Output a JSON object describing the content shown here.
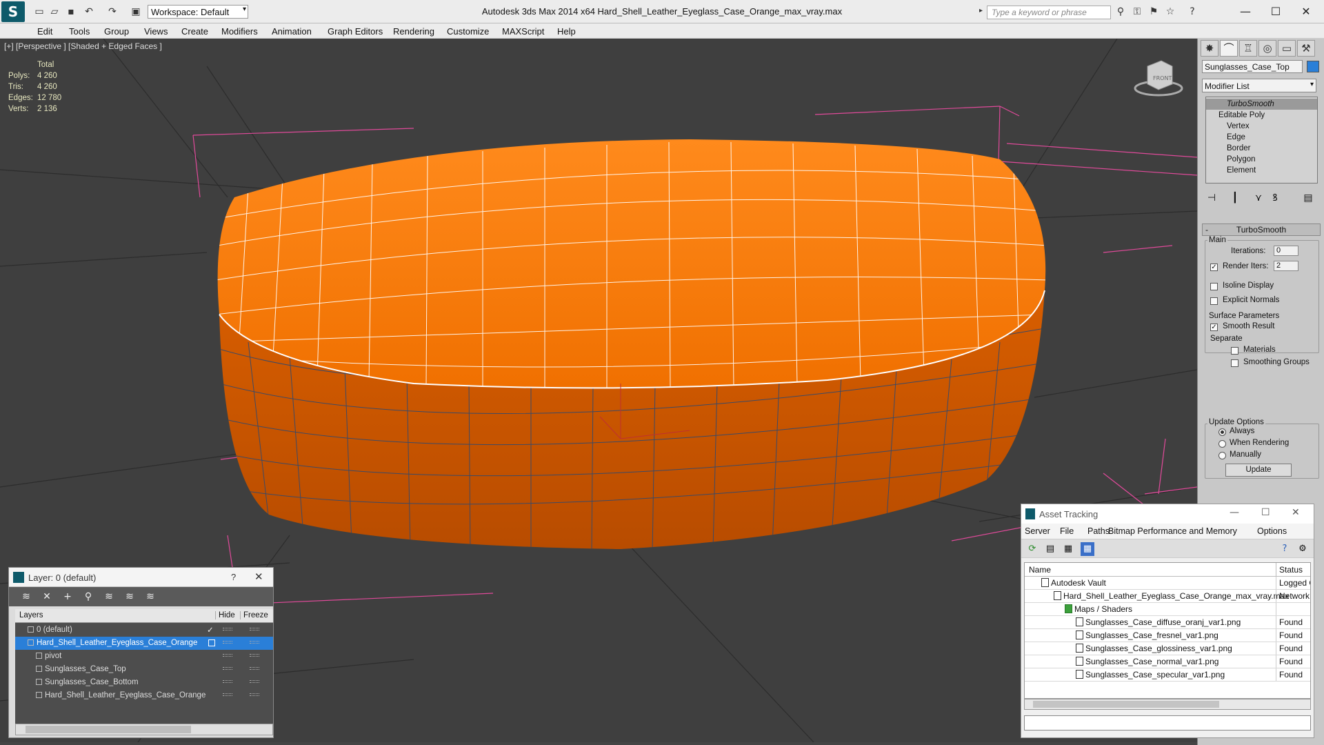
{
  "app": {
    "title": "Autodesk 3ds Max  2014 x64      Hard_Shell_Leather_Eyeglass_Case_Orange_max_vray.max",
    "workspace": "Workspace: Default",
    "search_placeholder": "Type a keyword or phrase",
    "app_letter": "S"
  },
  "menu": [
    "Edit",
    "Tools",
    "Group",
    "Views",
    "Create",
    "Modifiers",
    "Animation",
    "Graph Editors",
    "Rendering",
    "Customize",
    "MAXScript",
    "Help"
  ],
  "viewport": {
    "label": "[+] [Perspective ] [Shaded + Edged Faces ]",
    "stats_header": "Total",
    "stats": [
      {
        "label": "Polys:",
        "value": "4 260"
      },
      {
        "label": "Tris:",
        "value": "4 260"
      },
      {
        "label": "Edges:",
        "value": "12 780"
      },
      {
        "label": "Verts:",
        "value": "2 136"
      }
    ],
    "object_color": "#f06a00",
    "viewcube_label": "FRONT"
  },
  "command_panel": {
    "object_name": "Sunglasses_Case_Top",
    "modifier_list": "Modifier List",
    "stack": [
      "TurboSmooth",
      "Editable Poly",
      "Vertex",
      "Edge",
      "Border",
      "Polygon",
      "Element"
    ],
    "turbosmooth": {
      "title": "TurboSmooth",
      "main_label": "Main",
      "iterations_label": "Iterations:",
      "iterations": "0",
      "render_iters_label": "Render Iters:",
      "render_iters": "2",
      "isoline": "Isoline Display",
      "explicit_normals": "Explicit Normals",
      "surface_params": "Surface Parameters",
      "smooth_result": "Smooth Result",
      "separate": "Separate",
      "materials": "Materials",
      "smoothing_groups": "Smoothing Groups",
      "update_options": "Update Options",
      "always": "Always",
      "when_rendering": "When Rendering",
      "manually": "Manually",
      "update_button": "Update"
    }
  },
  "layer_dialog": {
    "title": "Layer: 0 (default)",
    "help": "?",
    "columns": {
      "layers": "Layers",
      "hide": "Hide",
      "freeze": "Freeze"
    },
    "rows": [
      {
        "name": "0 (default)",
        "indent": 1,
        "selected": false
      },
      {
        "name": "Hard_Shell_Leather_Eyeglass_Case_Orange",
        "indent": 1,
        "selected": true
      },
      {
        "name": "pivot",
        "indent": 2,
        "selected": false
      },
      {
        "name": "Sunglasses_Case_Top",
        "indent": 2,
        "selected": false
      },
      {
        "name": "Sunglasses_Case_Bottom",
        "indent": 2,
        "selected": false
      },
      {
        "name": "Hard_Shell_Leather_Eyeglass_Case_Orange",
        "indent": 2,
        "selected": false
      }
    ]
  },
  "asset_tracking": {
    "title": "Asset Tracking",
    "menu": [
      "Server",
      "File",
      "Paths",
      "Bitmap Performance and Memory",
      "Options"
    ],
    "columns": {
      "name": "Name",
      "status": "Status"
    },
    "rows": [
      {
        "name": "Autodesk Vault",
        "indent": 1,
        "status": "Logged Out"
      },
      {
        "name": "Hard_Shell_Leather_Eyeglass_Case_Orange_max_vray.max",
        "indent": 2,
        "status": "Network"
      },
      {
        "name": "Maps / Shaders",
        "indent": 3,
        "status": ""
      },
      {
        "name": "Sunglasses_Case_diffuse_oranj_var1.png",
        "indent": 4,
        "status": "Found"
      },
      {
        "name": "Sunglasses_Case_fresnel_var1.png",
        "indent": 4,
        "status": "Found"
      },
      {
        "name": "Sunglasses_Case_glossiness_var1.png",
        "indent": 4,
        "status": "Found"
      },
      {
        "name": "Sunglasses_Case_normal_var1.png",
        "indent": 4,
        "status": "Found"
      },
      {
        "name": "Sunglasses_Case_specular_var1.png",
        "indent": 4,
        "status": "Found"
      }
    ]
  }
}
